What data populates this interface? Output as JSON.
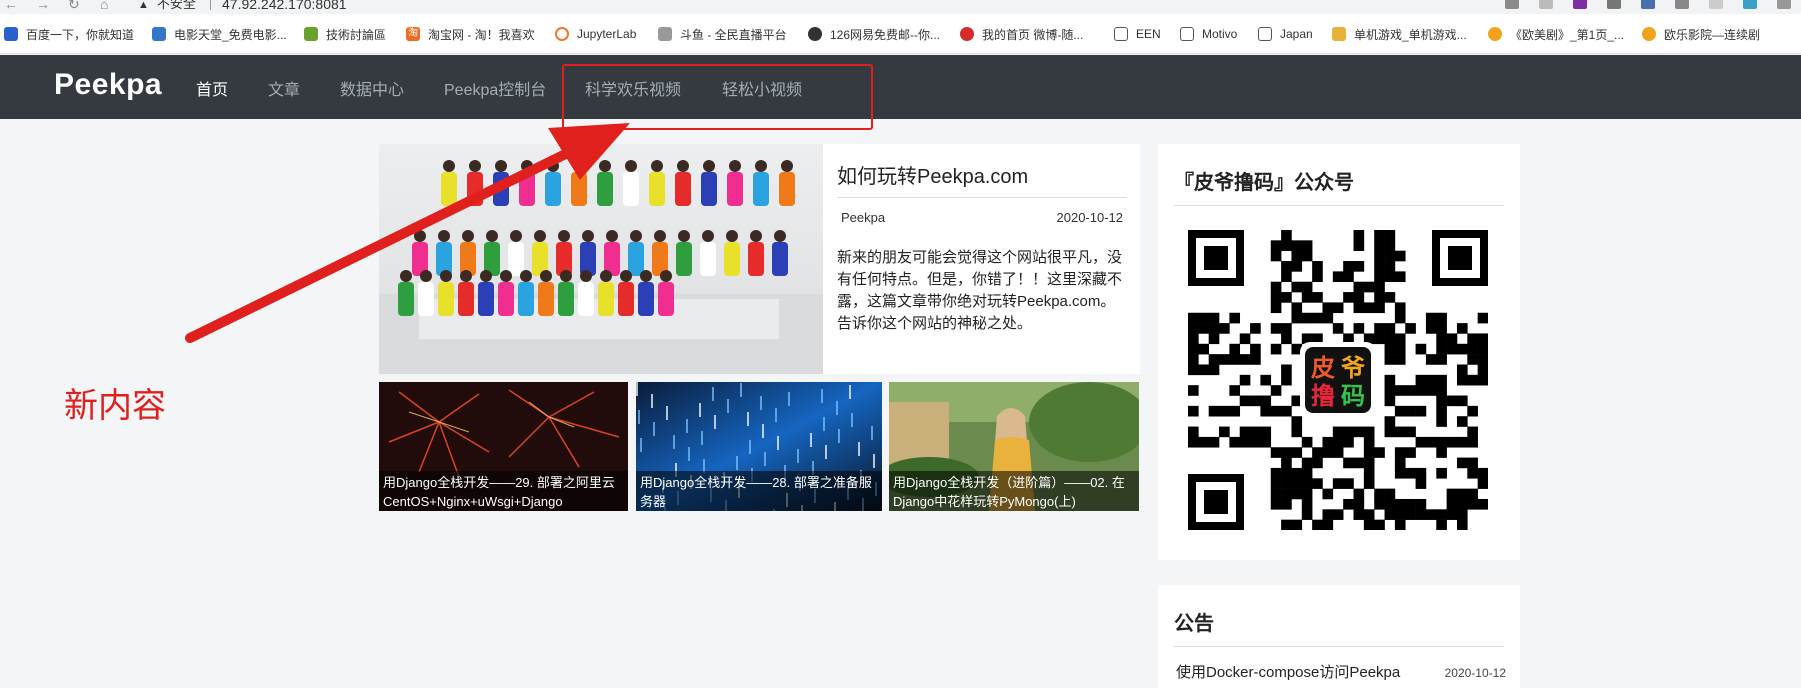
{
  "browser": {
    "security_label": "不安全",
    "address": "47.92.242.170:8081",
    "bookmarks": [
      {
        "label": "百度一下，你就知道",
        "icon": "baidu-icon"
      },
      {
        "label": "电影天堂_免费电影...",
        "icon": "movie-icon"
      },
      {
        "label": "技術討論區",
        "icon": "leaf-icon"
      },
      {
        "label": "淘宝网 - 淘！我喜欢",
        "icon": "taobao-icon"
      },
      {
        "label": "JupyterLab",
        "icon": "jupyter-icon"
      },
      {
        "label": "斗鱼 - 全民直播平台",
        "icon": "douyu-icon"
      },
      {
        "label": "126网易免费邮--你...",
        "icon": "globe-icon"
      },
      {
        "label": "我的首页 微博-随...",
        "icon": "weibo-icon"
      },
      {
        "label": "EEN",
        "icon": "folder-icon"
      },
      {
        "label": "Motivo",
        "icon": "folder-icon"
      },
      {
        "label": "Japan",
        "icon": "folder-icon"
      },
      {
        "label": "单机游戏_单机游戏...",
        "icon": "game-icon"
      },
      {
        "label": "《欧美剧》_第1页_...",
        "icon": "coin-icon"
      },
      {
        "label": "欧乐影院—连续剧",
        "icon": "coin-icon"
      }
    ]
  },
  "nav": {
    "brand": "Peekpa",
    "links": [
      "首页",
      "文章",
      "数据中心",
      "Peekpa控制台",
      "科学欢乐视频",
      "轻松小视频"
    ]
  },
  "annotation": {
    "text": "新内容",
    "color": "#e0201c"
  },
  "featured": {
    "title": "如何玩转Peekpa.com",
    "author": "Peekpa",
    "date": "2020-10-12",
    "excerpt": "新来的朋友可能会觉得这个网站很平凡，没有任何特点。但是，你错了！！这里深藏不露，这篇文章带你绝对玩转Peekpa.com。告诉你这个网站的神秘之处。"
  },
  "cards": [
    {
      "caption": "用Django全栈开发——29. 部署之阿里云CentOS+Nginx+uWsgi+Django",
      "image": "fireworks"
    },
    {
      "caption": "用Django全栈开发——28. 部署之准备服务器",
      "image": "server-lights"
    },
    {
      "caption": "用Django全栈开发（进阶篇）——02. 在Django中花样玩转PyMongo(上)",
      "image": "garden-portrait"
    }
  ],
  "sidebar": {
    "wechat_title": "『皮爷撸码』公众号",
    "qr_logo": [
      "皮",
      "爷",
      "撸",
      "码"
    ],
    "notice_title": "公告",
    "notices": [
      {
        "title": "使用Docker-compose访问Peekpa",
        "date": "2020-10-12"
      }
    ]
  },
  "colors": {
    "nav_bg": "#343a40",
    "nav_active": "#ffffff",
    "nav_inactive": "#a5acb3",
    "page_bg": "#f4f5f7",
    "annotation_red": "#e0201c"
  }
}
